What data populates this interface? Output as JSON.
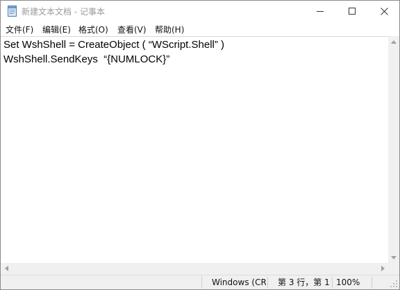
{
  "window": {
    "title": "新建文本文档 - 记事本",
    "minimize_icon": "minimize-icon",
    "maximize_icon": "maximize-icon",
    "close_icon": "close-icon"
  },
  "menu": {
    "items": [
      {
        "label": "文件(F)"
      },
      {
        "label": "编辑(E)"
      },
      {
        "label": "格式(O)"
      },
      {
        "label": "查看(V)"
      },
      {
        "label": "帮助(H)"
      }
    ]
  },
  "editor": {
    "lines": [
      "Set WshShell = CreateObject ( “WScript.Shell” )",
      "WshShell.SendKeys  “{NUMLOCK}”"
    ]
  },
  "status": {
    "line_ending": "Windows (CR",
    "cursor": "第 3 行，第 1",
    "zoom": "100%"
  },
  "colors": {
    "status_bg": "#f0f0f0",
    "title_text": "#9a9a9a"
  }
}
